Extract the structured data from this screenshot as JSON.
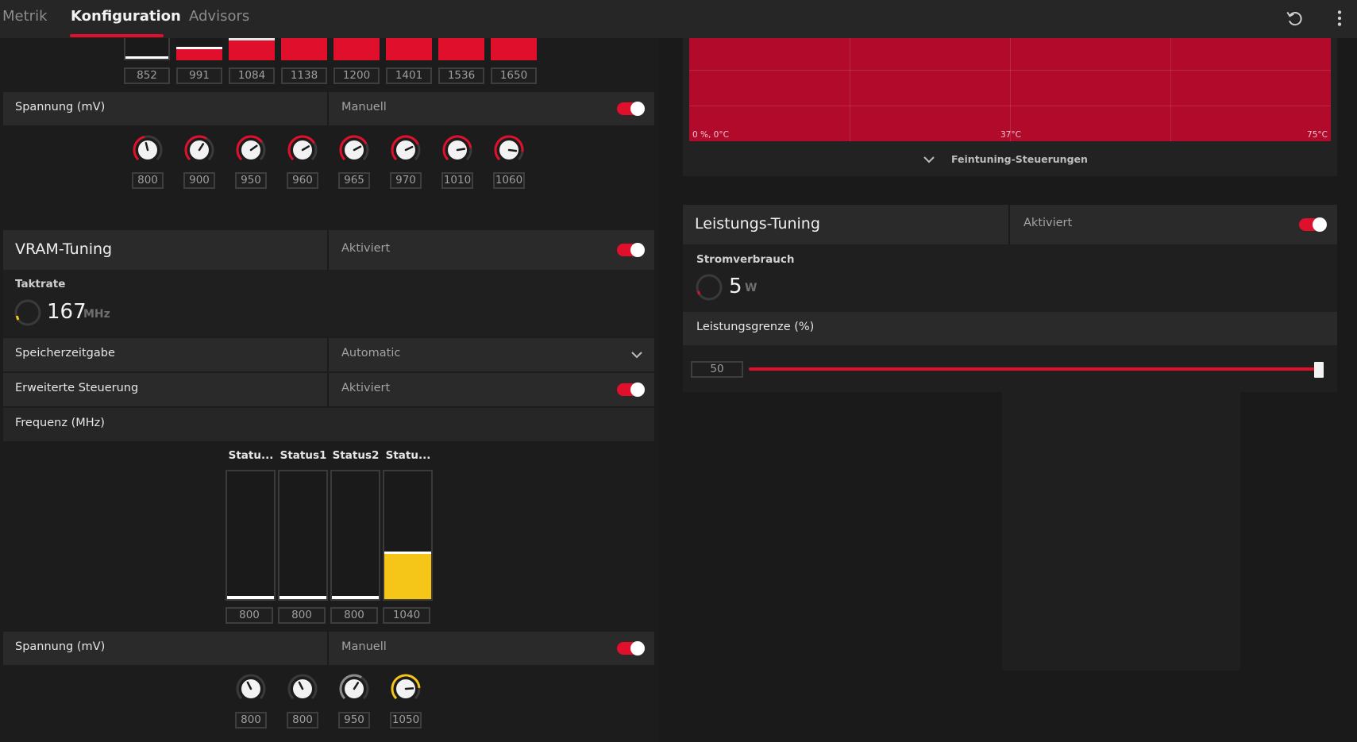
{
  "tabs": [
    {
      "label": "Metrik",
      "active": false
    },
    {
      "label": "Konfiguration",
      "active": true
    },
    {
      "label": "Advisors",
      "active": false
    }
  ],
  "toolbar": {
    "reset_icon": "reset-icon",
    "menu_icon": "more-vertical-icon"
  },
  "colors": {
    "accent": "#e0102c",
    "yellow": "#f5c518",
    "chart_red": "#b10a2b"
  },
  "gpu": {
    "freq_values": [
      "852",
      "991",
      "1084",
      "1138",
      "1200",
      "1401",
      "1536",
      "1650"
    ],
    "voltage": {
      "label": "Spannung (mV)",
      "mode": "Manuell",
      "enabled": true,
      "values": [
        "800",
        "900",
        "950",
        "960",
        "965",
        "970",
        "1010",
        "1060"
      ]
    }
  },
  "vram": {
    "title": "VRAM-Tuning",
    "status": "Aktiviert",
    "enabled": true,
    "clock": {
      "label": "Taktrate",
      "value": "167",
      "unit": "MHz"
    },
    "memory_timing": {
      "label": "Speicherzeitgabe",
      "value": "Automatic"
    },
    "advanced": {
      "label": "Erweiterte Steuerung",
      "status": "Aktiviert",
      "enabled": true
    },
    "frequency": {
      "label": "Frequenz (MHz)",
      "states": [
        {
          "label": "Statu...",
          "value": "800"
        },
        {
          "label": "Status1",
          "value": "800"
        },
        {
          "label": "Status2",
          "value": "800"
        },
        {
          "label": "Statu...",
          "value": "1040"
        }
      ]
    },
    "voltage": {
      "label": "Spannung (mV)",
      "mode": "Manuell",
      "enabled": true,
      "values": [
        "800",
        "800",
        "950",
        "1050"
      ]
    }
  },
  "fan_chart": {
    "labels": {
      "left": "0 %, 0°C",
      "mid": "37°C",
      "right": "75°C"
    },
    "fine_tuning": "Feintuning-Steuerungen"
  },
  "power": {
    "title": "Leistungs-Tuning",
    "status": "Aktiviert",
    "enabled": true,
    "consumption": {
      "label": "Stromverbrauch",
      "value": "5",
      "unit": "W"
    },
    "limit": {
      "label": "Leistungsgrenze (%)",
      "value": "50",
      "level": 1.0
    }
  }
}
